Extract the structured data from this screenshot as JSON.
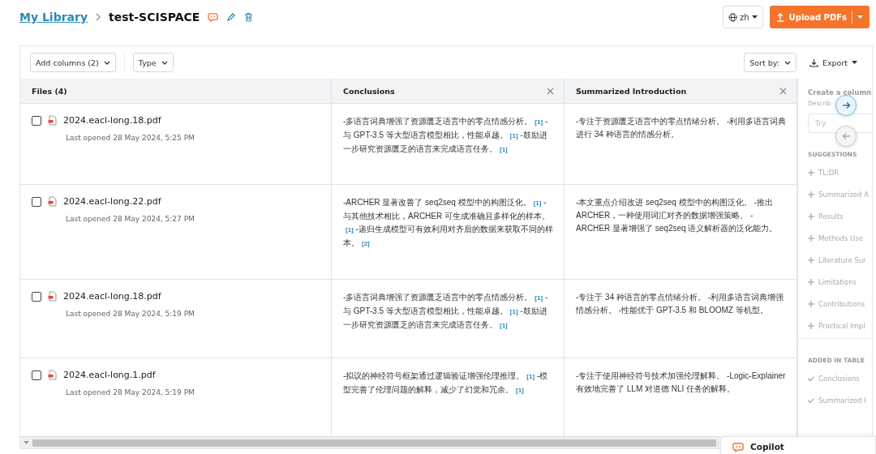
{
  "breadcrumb": {
    "parent": "My Library",
    "current": "test-SCISPACE"
  },
  "language": {
    "label": "zh"
  },
  "upload": {
    "label": "Upload PDFs"
  },
  "toolbar": {
    "add_columns": "Add columns (2)",
    "type": "Type",
    "sort": "Sort by:",
    "export": "Export"
  },
  "table": {
    "columns": [
      {
        "label": "Files (4)",
        "closable": false
      },
      {
        "label": "Conclusions",
        "closable": true
      },
      {
        "label": "Summarized Introduction",
        "closable": true
      }
    ],
    "rows": [
      {
        "file": "2024.eacl-long.18.pdf",
        "opened": "Last opened 28 May 2024, 5:25 PM",
        "checked": false,
        "conclusions": [
          {
            "text": "-多语言词典增强了资源匮乏语言中的零点情感分析。",
            "cite": "[1]"
          },
          {
            "text": " -与 GPT-3.5 等大型语言模型相比，性能卓越。",
            "cite": "[1]"
          },
          {
            "text": " -鼓励进一步研究资源匮乏的语言来完成语言任务。",
            "cite": "[1]"
          }
        ],
        "summary": "-专注于资源匮乏语言中的零点情绪分析。 -利用多语言词典进行 34 种语言的情感分析。"
      },
      {
        "file": "2024.eacl-long.22.pdf",
        "opened": "Last opened 28 May 2024, 5:27 PM",
        "checked": false,
        "conclusions": [
          {
            "text": "-ARCHER 显著改善了 seq2seq 模型中的构图泛化。",
            "cite": "[1]"
          },
          {
            "text": " -与其他技术相比，ARCHER 可生成准确且多样化的样本。",
            "cite": "[1]"
          },
          {
            "text": " -递归生成模型可有效利用对齐后的数据来获取不同的样本。",
            "cite": "[2]"
          }
        ],
        "summary": "-本文重点介绍改进 seq2seq 模型中的构图泛化。 -推出 ARCHER，一种使用词汇对齐的数据增强策略。 -ARCHER 显著增强了 seq2seq 语义解析器的泛化能力。"
      },
      {
        "file": "2024.eacl-long.18.pdf",
        "opened": "Last opened 28 May 2024, 5:19 PM",
        "checked": false,
        "conclusions": [
          {
            "text": "-多语言词典增强了资源匮乏语言中的零点情感分析。",
            "cite": "[1]"
          },
          {
            "text": " -与 GPT-3.5 等大型语言模型相比，性能卓越。",
            "cite": "[1]"
          },
          {
            "text": " -鼓励进一步研究资源匮乏的语言来完成语言任务。",
            "cite": "[1]"
          }
        ],
        "summary": "-专注于 34 种语言的零点情绪分析。 -利用多语言词典增强情感分析。 -性能优于 GPT-3.5 和 BLOOMZ 等机型。"
      },
      {
        "file": "2024.eacl-long.1.pdf",
        "opened": "Last opened 28 May 2024, 5:19 PM",
        "checked": false,
        "conclusions": [
          {
            "text": "-拟议的神经符号框架通过逻辑验证增强伦理推理。",
            "cite": "[1]"
          },
          {
            "text": " -模型完善了伦理问题的解释，减少了幻觉和冗余。",
            "cite": "[1]"
          }
        ],
        "summary": "-专注于使用神经符号技术加强伦理解释。 -Logic-Explainer 有效地完善了 LLM 对道德 NLI 任务的解释。"
      }
    ]
  },
  "panel": {
    "title": "Create a column",
    "describe": "Describ",
    "placeholder": "Try",
    "suggestions_heading": "SUGGESTIONS",
    "suggestions": [
      "TL;DR",
      "Summarized A",
      "Results",
      "Methods Use",
      "Literature Sur",
      "Limitations",
      "Contributions",
      "Practical Impl"
    ],
    "added_heading": "ADDED IN TABLE",
    "added": [
      "Conclusions",
      "Summarized I"
    ]
  },
  "copilot": {
    "label": "Copilot"
  }
}
